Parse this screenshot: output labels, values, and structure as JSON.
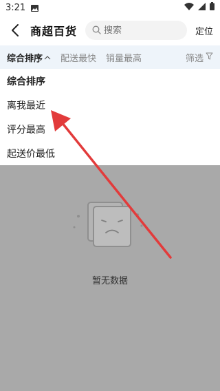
{
  "status_bar": {
    "time": "3:21"
  },
  "nav": {
    "title": "商超百货",
    "search_placeholder": "搜索",
    "locate_label": "定位"
  },
  "sort_bar": {
    "tabs": [
      {
        "label": "综合排序"
      },
      {
        "label": "配送最快"
      },
      {
        "label": "销量最高"
      }
    ],
    "filter_label": "筛选"
  },
  "sort_menu": {
    "items": [
      {
        "label": "综合排序"
      },
      {
        "label": "离我最近"
      },
      {
        "label": "评分最高"
      },
      {
        "label": "起送价最低"
      }
    ]
  },
  "empty_state": {
    "message": "暂无数据"
  },
  "annotation": {
    "arrow_color": "#e23b3b"
  }
}
